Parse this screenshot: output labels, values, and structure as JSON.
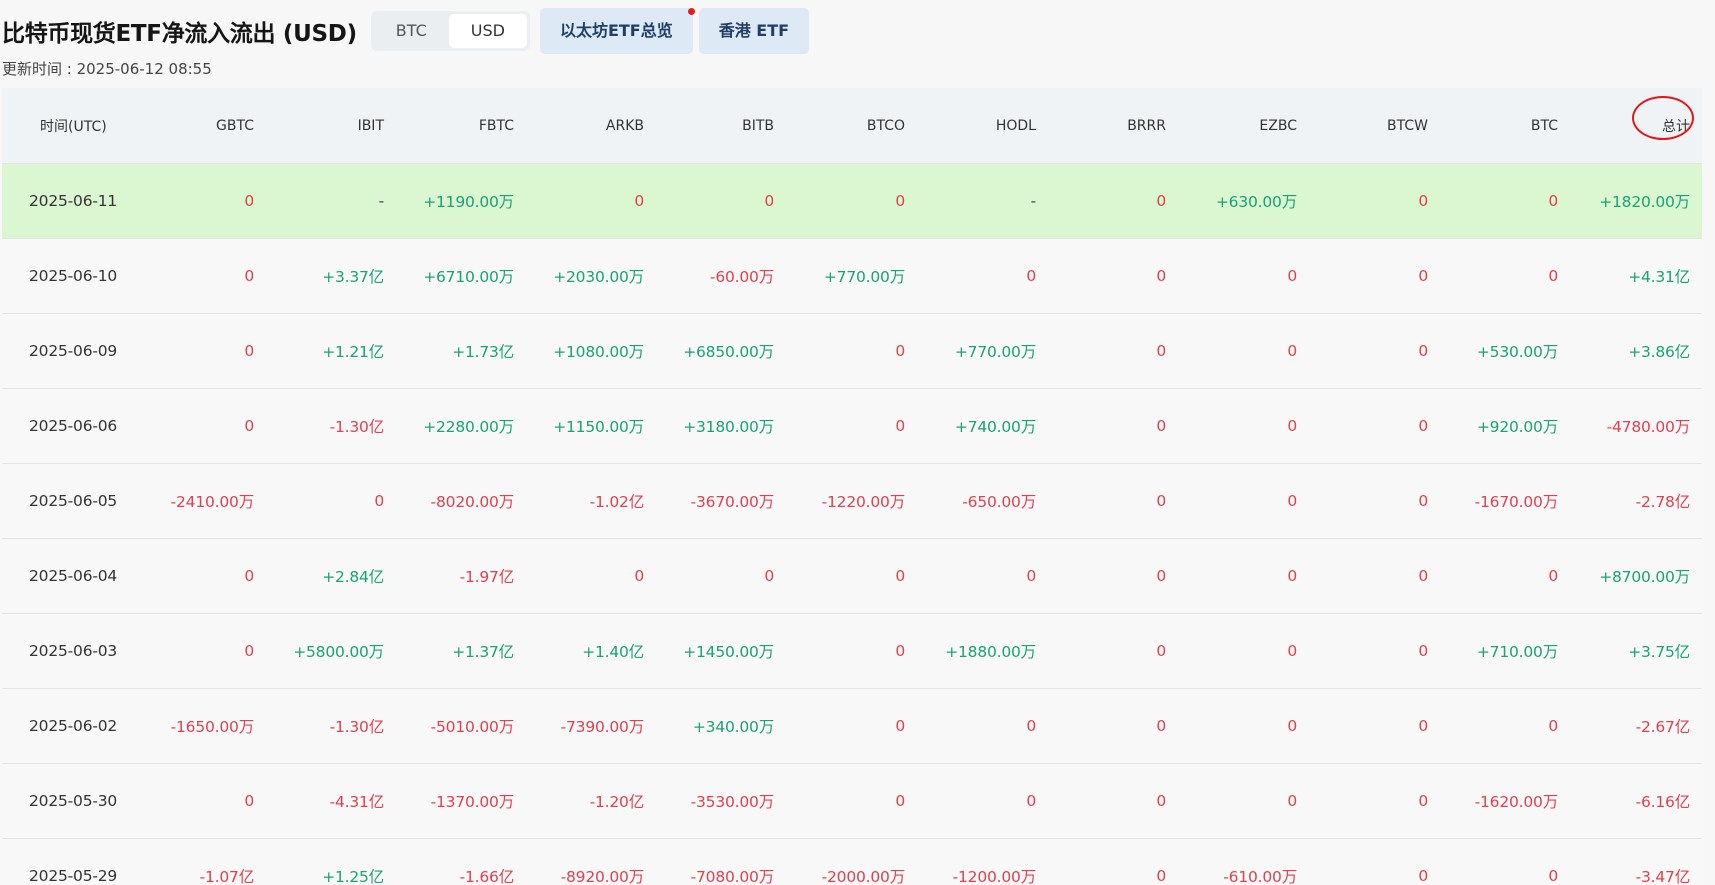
{
  "title": "比特币现货ETF净流入流出 (USD)",
  "unit_toggle": {
    "options": [
      "BTC",
      "USD"
    ],
    "selected": "USD"
  },
  "link_tabs": [
    "以太坊ETF总览",
    "香港 ETF"
  ],
  "update_time": "更新时间 : 2025-06-12 08:55",
  "table": {
    "columns": [
      "时间(UTC)",
      "GBTC",
      "IBIT",
      "FBTC",
      "ARKB",
      "BITB",
      "BTCO",
      "HODL",
      "BRRR",
      "EZBC",
      "BTCW",
      "BTC",
      "总计"
    ],
    "rows": [
      [
        "2025-06-11",
        "0",
        "-",
        "+1190.00万",
        "0",
        "0",
        "0",
        "-",
        "0",
        "+630.00万",
        "0",
        "0",
        "+1820.00万"
      ],
      [
        "2025-06-10",
        "0",
        "+3.37亿",
        "+6710.00万",
        "+2030.00万",
        "-60.00万",
        "+770.00万",
        "0",
        "0",
        "0",
        "0",
        "0",
        "+4.31亿"
      ],
      [
        "2025-06-09",
        "0",
        "+1.21亿",
        "+1.73亿",
        "+1080.00万",
        "+6850.00万",
        "0",
        "+770.00万",
        "0",
        "0",
        "0",
        "+530.00万",
        "+3.86亿"
      ],
      [
        "2025-06-06",
        "0",
        "-1.30亿",
        "+2280.00万",
        "+1150.00万",
        "+3180.00万",
        "0",
        "+740.00万",
        "0",
        "0",
        "0",
        "+920.00万",
        "-4780.00万"
      ],
      [
        "2025-06-05",
        "-2410.00万",
        "0",
        "-8020.00万",
        "-1.02亿",
        "-3670.00万",
        "-1220.00万",
        "-650.00万",
        "0",
        "0",
        "0",
        "-1670.00万",
        "-2.78亿"
      ],
      [
        "2025-06-04",
        "0",
        "+2.84亿",
        "-1.97亿",
        "0",
        "0",
        "0",
        "0",
        "0",
        "0",
        "0",
        "0",
        "+8700.00万"
      ],
      [
        "2025-06-03",
        "0",
        "+5800.00万",
        "+1.37亿",
        "+1.40亿",
        "+1450.00万",
        "0",
        "+1880.00万",
        "0",
        "0",
        "0",
        "+710.00万",
        "+3.75亿"
      ],
      [
        "2025-06-02",
        "-1650.00万",
        "-1.30亿",
        "-5010.00万",
        "-7390.00万",
        "+340.00万",
        "0",
        "0",
        "0",
        "0",
        "0",
        "0",
        "-2.67亿"
      ],
      [
        "2025-05-30",
        "0",
        "-4.31亿",
        "-1370.00万",
        "-1.20亿",
        "-3530.00万",
        "0",
        "0",
        "0",
        "0",
        "0",
        "-1620.00万",
        "-6.16亿"
      ],
      [
        "2025-05-29",
        "-1.07亿",
        "+1.25亿",
        "-1.66亿",
        "-8920.00万",
        "-7080.00万",
        "-2000.00万",
        "-1200.00万",
        "0",
        "-610.00万",
        "0",
        "0",
        "-3.47亿"
      ]
    ],
    "highlight_row": 0
  },
  "colors": {
    "positive": "#19a374",
    "negative": "#e0414f",
    "highlight_row_bg": "#dbf7d2",
    "header_bg": "#f0f3f6",
    "link_tab_bg": "#dde9f4",
    "annotation": "#e01818"
  }
}
